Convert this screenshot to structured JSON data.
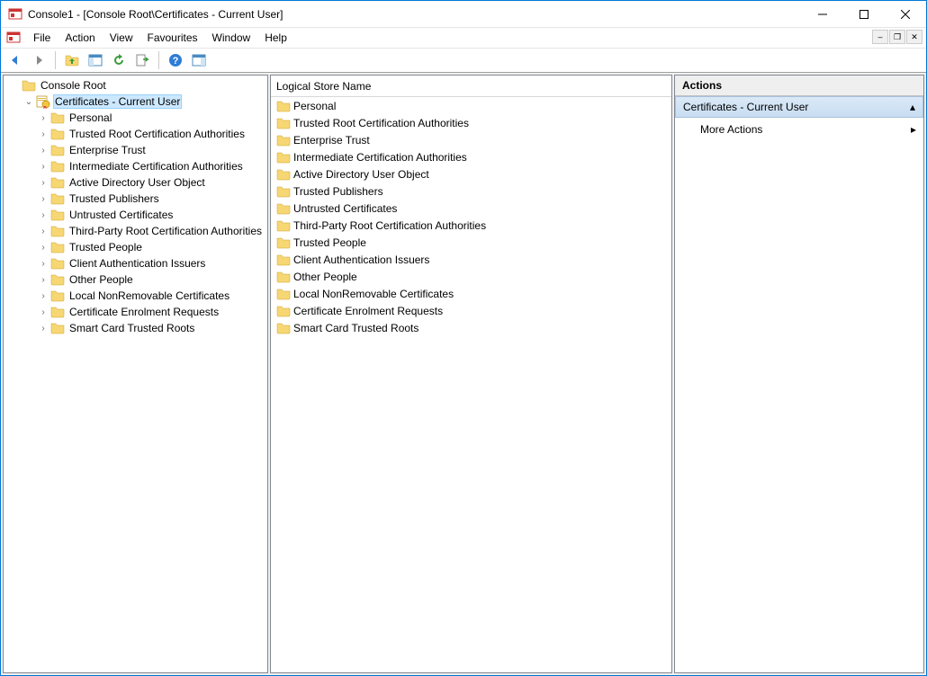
{
  "window": {
    "title": "Console1 - [Console Root\\Certificates - Current User]"
  },
  "menu": {
    "file": "File",
    "action": "Action",
    "view": "View",
    "favourites": "Favourites",
    "window": "Window",
    "help": "Help"
  },
  "tree": {
    "root": "Console Root",
    "selected": "Certificates - Current User",
    "children": [
      "Personal",
      "Trusted Root Certification Authorities",
      "Enterprise Trust",
      "Intermediate Certification Authorities",
      "Active Directory User Object",
      "Trusted Publishers",
      "Untrusted Certificates",
      "Third-Party Root Certification Authorities",
      "Trusted People",
      "Client Authentication Issuers",
      "Other People",
      "Local NonRemovable Certificates",
      "Certificate Enrolment Requests",
      "Smart Card Trusted Roots"
    ]
  },
  "list": {
    "header": "Logical Store Name",
    "items": [
      "Personal",
      "Trusted Root Certification Authorities",
      "Enterprise Trust",
      "Intermediate Certification Authorities",
      "Active Directory User Object",
      "Trusted Publishers",
      "Untrusted Certificates",
      "Third-Party Root Certification Authorities",
      "Trusted People",
      "Client Authentication Issuers",
      "Other People",
      "Local NonRemovable Certificates",
      "Certificate Enrolment Requests",
      "Smart Card Trusted Roots"
    ]
  },
  "actions": {
    "header": "Actions",
    "section": "Certificates - Current User",
    "more": "More Actions"
  }
}
